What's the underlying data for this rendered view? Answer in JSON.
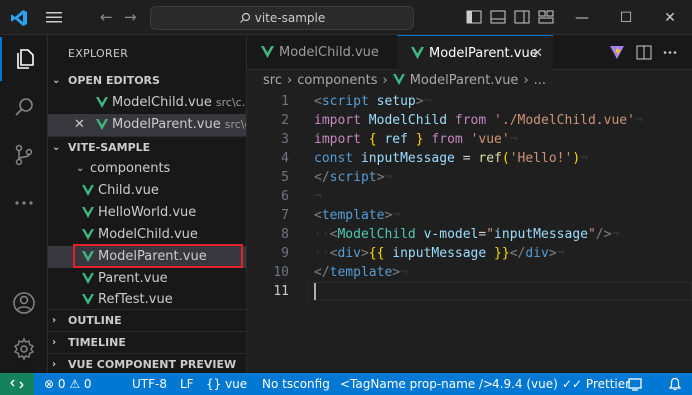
{
  "titlebar": {
    "search_text": "vite-sample",
    "back_glyph": "←",
    "forward_glyph": "→",
    "minimize_glyph": "—",
    "maximize_glyph": "☐",
    "close_glyph": "✕"
  },
  "sidebar": {
    "title": "EXPLORER",
    "open_editors": {
      "header": "OPEN EDITORS",
      "items": [
        {
          "name": "ModelChild.vue",
          "desc": "src\\c..."
        },
        {
          "name": "ModelParent.vue",
          "desc": "src\\c..."
        }
      ]
    },
    "workspace": {
      "header": "VITE-SAMPLE",
      "folder": "components",
      "files": [
        "Child.vue",
        "HelloWorld.vue",
        "ModelChild.vue",
        "ModelParent.vue",
        "Parent.vue",
        "RefTest.vue"
      ]
    },
    "outline": "OUTLINE",
    "timeline": "TIMELINE",
    "vue_preview": "VUE COMPONENT PREVIEW"
  },
  "tabs": [
    {
      "label": "ModelChild.vue",
      "active": false
    },
    {
      "label": "ModelParent.vue",
      "active": true
    }
  ],
  "breadcrumb": {
    "items": [
      "src",
      "components",
      "ModelParent.vue",
      "..."
    ]
  },
  "editor": {
    "line_numbers": [
      "1",
      "2",
      "3",
      "4",
      "5",
      "6",
      "7",
      "8",
      "9",
      "10",
      "11"
    ],
    "current_line": 11
  },
  "statusbar": {
    "problems": "⊗ 0 ⚠ 0",
    "encoding": "UTF-8",
    "eol": "LF",
    "language": "{} vue",
    "tsconfig": "No tsconfig",
    "tagname": "<TagName prop-name />",
    "version": "4.9.4 (vue)",
    "prettier": "✓✓ Prettier"
  },
  "colors": {
    "accent": "#0078d4",
    "vue_green": "#41b883",
    "highlight_red": "#e0242c",
    "remote_green": "#16825d"
  },
  "icons": {
    "explorer": "files-icon",
    "search": "search-icon",
    "scm": "source-control-icon",
    "more": "ellipsis-icon",
    "account": "account-icon",
    "settings": "gear-icon"
  }
}
